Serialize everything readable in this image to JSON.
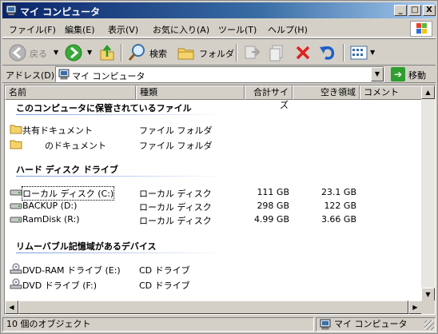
{
  "window": {
    "title": "マイ コンピュータ",
    "controls": {
      "minimize": "_",
      "maximize": "□",
      "close": "X"
    }
  },
  "menu": {
    "items": [
      "ファイル(F)",
      "編集(E)",
      "表示(V)",
      "お気に入り(A)",
      "ツール(T)",
      "ヘルプ(H)"
    ]
  },
  "toolbar": {
    "back_label": "戻る",
    "search_label": "検索",
    "folders_label": "フォルダ"
  },
  "address": {
    "label": "アドレス(D)",
    "value": "マイ コンピュータ",
    "go_label": "移動"
  },
  "columns": [
    "名前",
    "種類",
    "合計サイズ",
    "空き領域",
    "コメント"
  ],
  "groups": [
    {
      "title": "このコンピュータに保管されているファイル",
      "items": [
        {
          "name": "共有ドキュメント",
          "type": "ファイル フォルダ",
          "total": "",
          "free": "",
          "icon": "folder-icon"
        },
        {
          "name": "        のドキュメント",
          "type": "ファイル フォルダ",
          "total": "",
          "free": "",
          "icon": "folder-icon"
        }
      ]
    },
    {
      "title": "ハード ディスク ドライブ",
      "items": [
        {
          "name": "ローカル ディスク (C:)",
          "type": "ローカル ディスク",
          "total": "111 GB",
          "free": "23.1 GB",
          "icon": "hard-drive-icon"
        },
        {
          "name": "BACKUP (D:)",
          "type": "ローカル ディスク",
          "total": "298 GB",
          "free": "122 GB",
          "icon": "hard-drive-icon"
        },
        {
          "name": "RamDisk (R:)",
          "type": "ローカル ディスク",
          "total": "4.99 GB",
          "free": "3.66 GB",
          "icon": "hard-drive-icon"
        }
      ]
    },
    {
      "title": "リムーバブル記憶域があるデバイス",
      "items": [
        {
          "name": "DVD-RAM ドライブ (E:)",
          "type": "CD ドライブ",
          "total": "",
          "free": "",
          "icon": "dvd-drive-icon"
        },
        {
          "name": "DVD ドライブ (F:)",
          "type": "CD ドライブ",
          "total": "",
          "free": "",
          "icon": "dvd-drive-icon"
        }
      ]
    }
  ],
  "status": {
    "left": "10 個のオブジェクト",
    "right": "マイ コンピュータ"
  },
  "colors": {
    "title_gradient_start": "#0a246a",
    "window_face": "#d4d0c8",
    "delete_red": "#e02020",
    "group_line": "#7a96df"
  }
}
